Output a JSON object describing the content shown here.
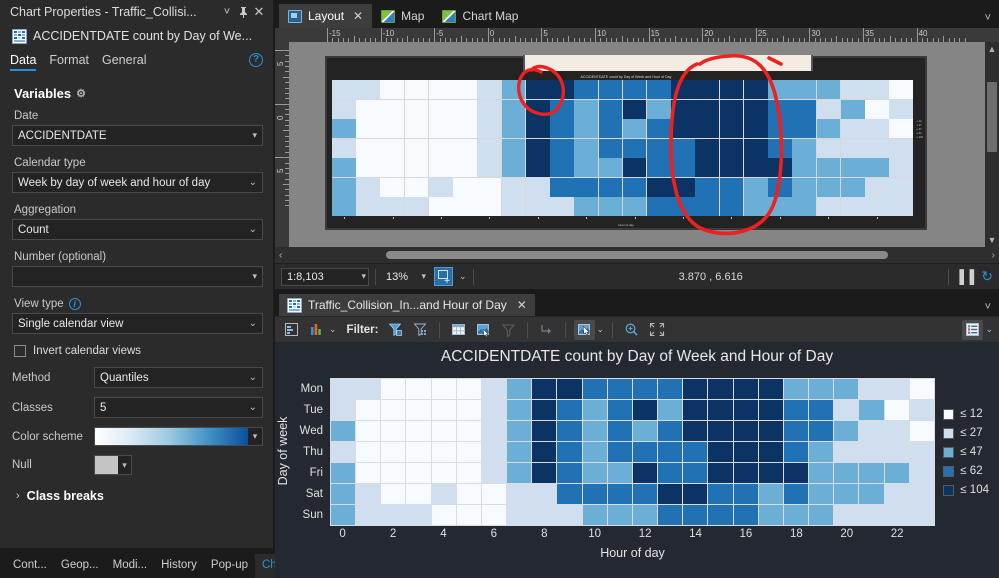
{
  "left_panel": {
    "title": "Chart Properties - Traffic_Collisi...",
    "subtitle": "ACCIDENTDATE count by Day of We...",
    "icons": {
      "dropdown": "˅",
      "pin": "✐",
      "close": "✕",
      "help": "?"
    },
    "tabs": [
      {
        "label": "Data",
        "active": true
      },
      {
        "label": "Format",
        "active": false
      },
      {
        "label": "General",
        "active": false
      }
    ],
    "section_title": "Variables",
    "fields": {
      "date_label": "Date",
      "date_value": "ACCIDENTDATE",
      "calendar_type_label": "Calendar type",
      "calendar_type_value": "Week by day of week and hour of day",
      "aggregation_label": "Aggregation",
      "aggregation_value": "Count",
      "number_label": "Number (optional)",
      "number_value": "",
      "view_type_label": "View type",
      "view_type_value": "Single calendar view",
      "invert_label": "Invert calendar views",
      "invert_checked": false,
      "method_label": "Method",
      "method_value": "Quantiles",
      "classes_label": "Classes",
      "classes_value": "5",
      "color_scheme_label": "Color scheme",
      "null_label": "Null"
    },
    "expander_label": "Class breaks",
    "expander_chevron": "›"
  },
  "bottom_tabs": [
    {
      "label": "Cont...",
      "active": false
    },
    {
      "label": "Geop...",
      "active": false
    },
    {
      "label": "Modi...",
      "active": false
    },
    {
      "label": "History",
      "active": false
    },
    {
      "label": "Pop-up",
      "active": false
    },
    {
      "label": "Chart...",
      "active": true
    }
  ],
  "layout_view": {
    "tabs": [
      {
        "label": "Layout",
        "icon": "layout-icon",
        "active": true,
        "closable": true
      },
      {
        "label": "Map",
        "icon": "map-icon",
        "active": false,
        "closable": false
      },
      {
        "label": "Chart Map",
        "icon": "map-icon",
        "active": false,
        "closable": false
      }
    ],
    "collapse_icon": "˅",
    "ruler_labels_h": [
      "-15",
      "-10",
      "-5",
      "0",
      "5",
      "10",
      "15",
      "20",
      "25",
      "30",
      "35",
      "40"
    ],
    "ruler_labels_v": [
      "5",
      "0",
      "5"
    ],
    "status": {
      "scale": "1:8,103",
      "zoom": "13%",
      "coordinates": "3.870 , 6.616",
      "pause_icon": "▐▐",
      "refresh_icon": "↻"
    },
    "annotations": [
      {
        "name": "red-circle-small",
        "shape": "freehand-loop"
      },
      {
        "name": "red-circle-large",
        "shape": "freehand-loop"
      }
    ]
  },
  "chart_panel": {
    "tab_label": "Traffic_Collision_In...and Hour of Day",
    "tab_close": "✕",
    "collapse_icon": "˅",
    "toolbar": {
      "filter_label": "Filter:",
      "buttons": [
        "chart-properties-icon",
        "chart-type-icon",
        "filter-selection-icon",
        "filter-extent-icon",
        "open-table-icon",
        "select-features-icon",
        "clear-filter-icon",
        "switch-selection-icon",
        "selection-tool-icon",
        "zoom-in-icon",
        "full-extent-icon",
        "legend-toggle-icon"
      ],
      "caret": "˅"
    }
  },
  "chart_data": {
    "type": "heatmap",
    "title": "ACCIDENTDATE count by Day of Week and Hour of Day",
    "xlabel": "Hour of day",
    "ylabel": "Day of week",
    "xtick_labels": [
      "0",
      "2",
      "4",
      "6",
      "8",
      "10",
      "12",
      "14",
      "16",
      "18",
      "20",
      "22"
    ],
    "xtick_positions": [
      0,
      2,
      4,
      6,
      8,
      10,
      12,
      14,
      16,
      18,
      20,
      22
    ],
    "categories_x": [
      0,
      1,
      2,
      3,
      4,
      5,
      6,
      7,
      8,
      9,
      10,
      11,
      12,
      13,
      14,
      15,
      16,
      17,
      18,
      19,
      20,
      21,
      22,
      23
    ],
    "categories_y": [
      "Mon",
      "Tue",
      "Wed",
      "Thu",
      "Fri",
      "Sat",
      "Sun"
    ],
    "legend_position": "right",
    "legend": [
      {
        "label": "≤ 12",
        "color": "#f7fbff"
      },
      {
        "label": "≤ 27",
        "color": "#cfdff0"
      },
      {
        "label": "≤ 47",
        "color": "#6baed6"
      },
      {
        "label": "≤ 62",
        "color": "#2171b5"
      },
      {
        "label": "≤ 104",
        "color": "#0b3363"
      }
    ],
    "class_bins": [
      12,
      27,
      47,
      62,
      104
    ],
    "palette": [
      "#f7fbff",
      "#cfdff0",
      "#6baed6",
      "#2171b5",
      "#0b3363"
    ],
    "rows": [
      {
        "day": "Mon",
        "classes": [
          1,
          1,
          0,
          0,
          0,
          0,
          1,
          2,
          4,
          4,
          3,
          3,
          3,
          3,
          4,
          4,
          4,
          4,
          2,
          2,
          2,
          1,
          1,
          0
        ]
      },
      {
        "day": "Tue",
        "classes": [
          1,
          0,
          0,
          0,
          0,
          0,
          1,
          2,
          4,
          3,
          2,
          3,
          4,
          2,
          4,
          4,
          4,
          4,
          3,
          3,
          1,
          2,
          0,
          1
        ]
      },
      {
        "day": "Wed",
        "classes": [
          2,
          0,
          0,
          0,
          0,
          0,
          1,
          2,
          4,
          3,
          2,
          3,
          2,
          3,
          4,
          4,
          4,
          4,
          3,
          3,
          2,
          1,
          1,
          0
        ]
      },
      {
        "day": "Thu",
        "classes": [
          1,
          0,
          0,
          0,
          0,
          0,
          1,
          2,
          4,
          3,
          2,
          3,
          3,
          3,
          3,
          4,
          4,
          4,
          3,
          2,
          1,
          1,
          1,
          1
        ]
      },
      {
        "day": "Fri",
        "classes": [
          2,
          0,
          0,
          0,
          0,
          0,
          1,
          2,
          4,
          3,
          2,
          2,
          4,
          3,
          3,
          4,
          4,
          4,
          4,
          2,
          2,
          2,
          2,
          1
        ]
      },
      {
        "day": "Sat",
        "classes": [
          2,
          1,
          0,
          0,
          1,
          0,
          0,
          1,
          1,
          3,
          3,
          3,
          3,
          4,
          4,
          3,
          3,
          2,
          3,
          2,
          2,
          2,
          1,
          1
        ]
      },
      {
        "day": "Sun",
        "classes": [
          2,
          1,
          1,
          1,
          0,
          0,
          0,
          1,
          1,
          1,
          2,
          2,
          2,
          3,
          3,
          3,
          3,
          2,
          2,
          2,
          1,
          1,
          1,
          1
        ]
      }
    ]
  }
}
